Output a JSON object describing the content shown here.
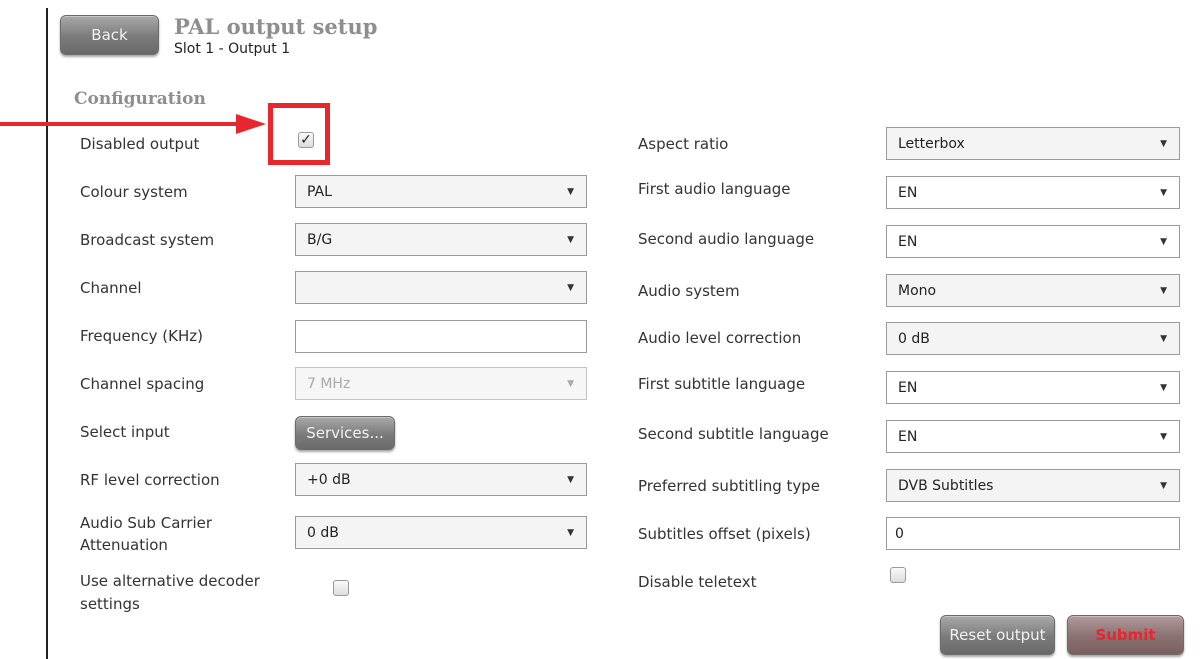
{
  "header": {
    "back_label": "Back",
    "title": "PAL output setup",
    "subtitle": "Slot 1 - Output 1"
  },
  "section": {
    "title": "Configuration"
  },
  "left": {
    "disabled_output": {
      "label": "Disabled output",
      "checked": true,
      "check_glyph": "✓"
    },
    "colour_system": {
      "label": "Colour system",
      "value": "PAL"
    },
    "broadcast_system": {
      "label": "Broadcast system",
      "value": "B/G"
    },
    "channel": {
      "label": "Channel",
      "value": ""
    },
    "frequency": {
      "label": "Frequency (KHz)",
      "value": ""
    },
    "channel_spacing": {
      "label": "Channel spacing",
      "value": "7 MHz",
      "disabled": true
    },
    "select_input": {
      "label": "Select input",
      "button_label": "Services..."
    },
    "rf_level": {
      "label": "RF level correction",
      "value": "+0 dB"
    },
    "audio_sub_carrier": {
      "label_line1": "Audio Sub Carrier",
      "label_line2": "Attenuation",
      "value": "0 dB"
    },
    "alt_decoder": {
      "label_line1": "Use alternative decoder",
      "label_line2": "settings",
      "checked": false
    }
  },
  "right": {
    "aspect_ratio": {
      "label": "Aspect ratio",
      "value": "Letterbox"
    },
    "first_audio_language": {
      "label": "First audio language",
      "value": "EN"
    },
    "second_audio_language": {
      "label": "Second audio language",
      "value": "EN"
    },
    "audio_system": {
      "label": "Audio system",
      "value": "Mono"
    },
    "audio_level_correction": {
      "label": "Audio level correction",
      "value": "0 dB"
    },
    "first_subtitle_language": {
      "label": "First subtitle language",
      "value": "EN"
    },
    "second_subtitle_language": {
      "label": "Second subtitle language",
      "value": "EN"
    },
    "preferred_subtitling_type": {
      "label": "Preferred subtitling type",
      "value": "DVB Subtitles"
    },
    "subtitles_offset": {
      "label": "Subtitles offset (pixels)",
      "value": "0"
    },
    "disable_teletext": {
      "label": "Disable teletext",
      "checked": false
    }
  },
  "footer": {
    "reset_label": "Reset output",
    "submit_label": "Submit"
  },
  "icons": {
    "dropdown": "▼"
  },
  "colors": {
    "callout": "#e8262d",
    "submit_text": "#e8262d",
    "heading": "#8e8e8e"
  }
}
